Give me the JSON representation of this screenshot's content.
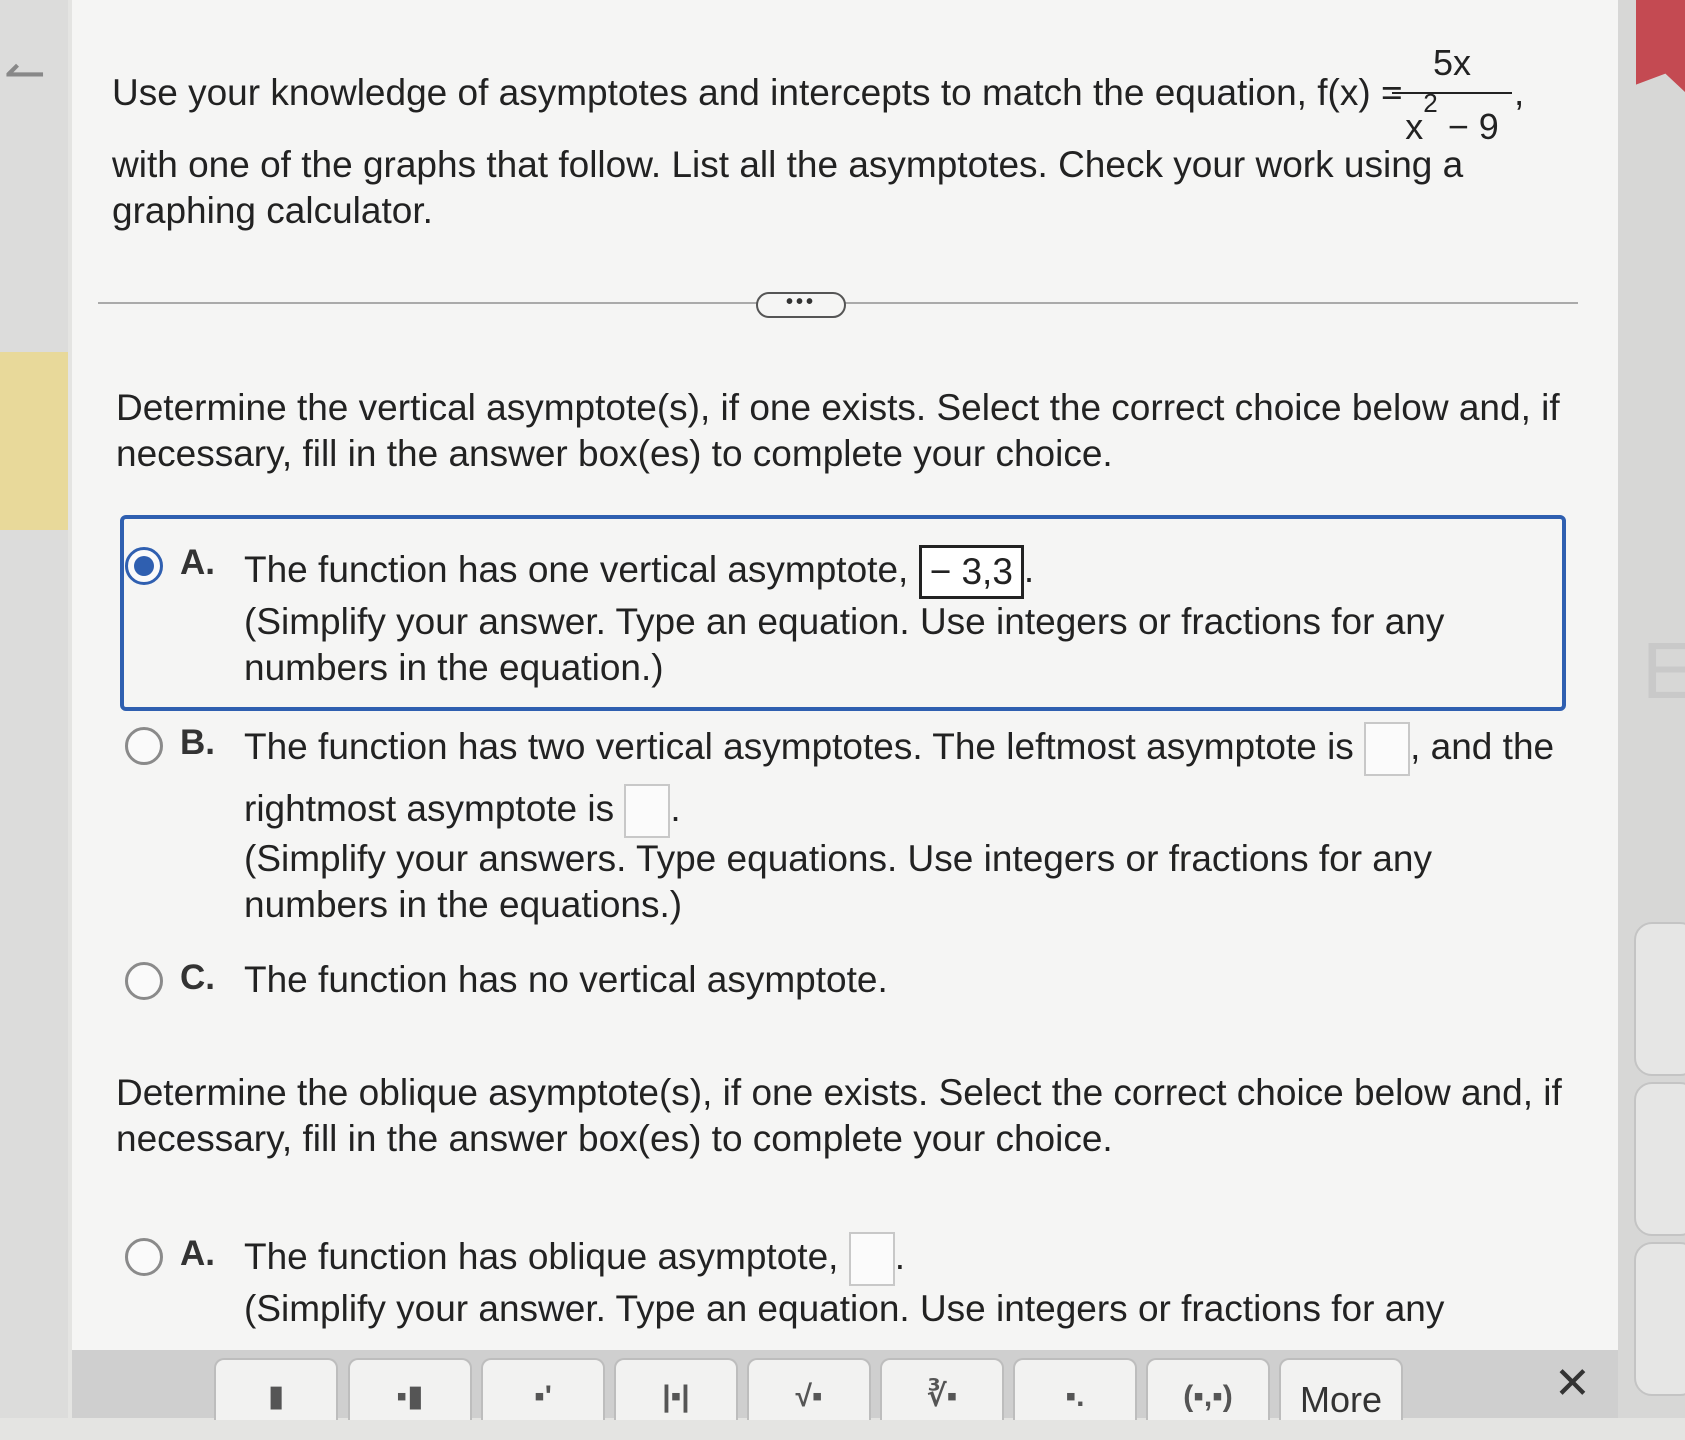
{
  "nav": {
    "back_icon": "back-arrow-icon"
  },
  "question": {
    "line1_text": "Use your knowledge of asymptotes and intercepts to match the equation, f(x) =",
    "fraction_numerator": "5x",
    "fraction_denominator_base": "x",
    "fraction_denominator_exp": "2",
    "fraction_denominator_rest": " − 9",
    "comma": ",",
    "line2_text": "with one of the graphs that follow. List all the asymptotes. Check your work using a",
    "line3_text": "graphing calculator."
  },
  "divider": {
    "more_label": "•••"
  },
  "vertical": {
    "prompt_line1": "Determine the vertical asymptote(s), if one exists. Select the correct choice below and, if",
    "prompt_line2": "necessary, fill in the answer box(es) to complete your choice.",
    "choices": [
      {
        "letter": "A.",
        "line1": "The function has one vertical asymptote,",
        "answer_value": "− 3,3",
        "line1_end": ".",
        "line2": "(Simplify your answer. Type an equation. Use integers or fractions for any",
        "line3": "numbers in the equation.)",
        "selected": true
      },
      {
        "letter": "B.",
        "line1": "The function has two vertical asymptotes. The leftmost asymptote is",
        "line1_end": ", and the",
        "line2": "rightmost asymptote is",
        "line2_end": ".",
        "line3": "(Simplify your answers. Type equations. Use integers or fractions for any",
        "line4": "numbers in the equations.)",
        "selected": false
      },
      {
        "letter": "C.",
        "line1": "The function has no vertical asymptote.",
        "selected": false
      }
    ]
  },
  "oblique": {
    "prompt_line1": "Determine the oblique asymptote(s), if one exists. Select the correct choice below and, if",
    "prompt_line2": "necessary, fill in the answer box(es) to complete your choice.",
    "choices": [
      {
        "letter": "A.",
        "line1": "The function has oblique asymptote,",
        "line1_end": ".",
        "line2": "(Simplify your answer. Type an equation. Use integers or fractions for any",
        "selected": false
      }
    ]
  },
  "toolbar": {
    "tools": [
      "▮",
      "▪▮",
      "▪'",
      "|▪|",
      "√▪",
      "∛▪",
      "▪.",
      "(▪,▪)"
    ],
    "more_label": "More",
    "close_label": "✕"
  },
  "colors": {
    "accent": "#2f5fb0",
    "flag": "#c44a52"
  }
}
